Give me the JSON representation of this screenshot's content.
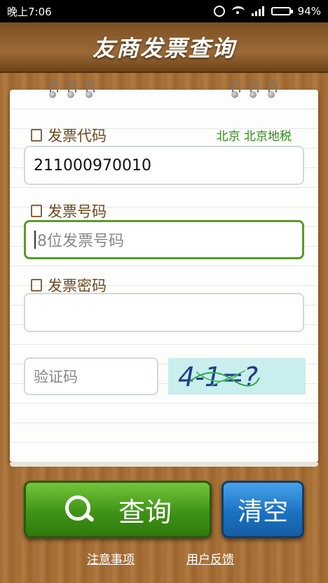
{
  "status_bar": {
    "time": "晚上7:06",
    "battery": "94%",
    "battery_level": 0.94
  },
  "header": {
    "title": "友商发票查询"
  },
  "form": {
    "region": "北京 北京地税",
    "invoice_code": {
      "label": "发票代码",
      "value": "211000970010",
      "icon": "document-copy-icon"
    },
    "invoice_number": {
      "label": "发票号码",
      "placeholder": "8位发票号码",
      "icon": "document-add-icon"
    },
    "invoice_password": {
      "label": "发票密码",
      "value": "",
      "icon": "edit-icon"
    },
    "captcha": {
      "placeholder": "验证码",
      "image_text": "4-1=?"
    }
  },
  "buttons": {
    "query": "查询",
    "clear": "清空"
  },
  "links": {
    "notice": "注意事项",
    "feedback": "用户反馈"
  }
}
